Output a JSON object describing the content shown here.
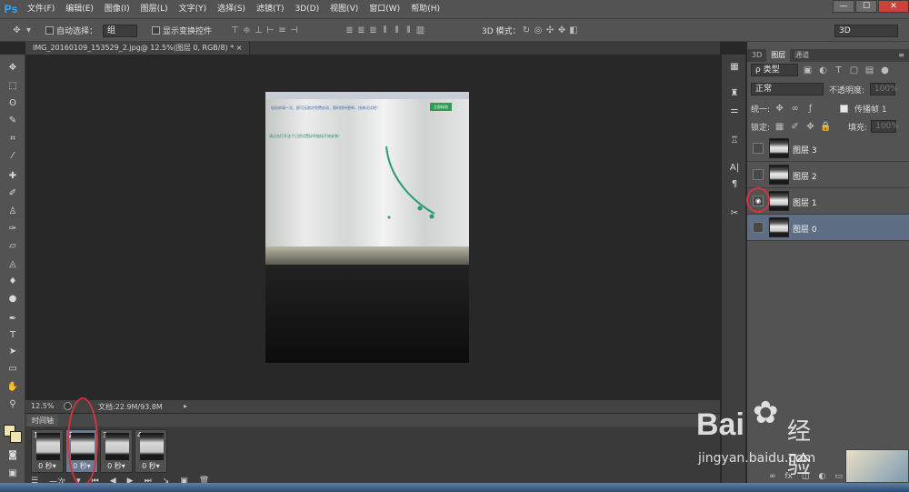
{
  "app": {
    "logo": "Ps"
  },
  "menu": [
    "文件(F)",
    "编辑(E)",
    "图像(I)",
    "图层(L)",
    "文字(Y)",
    "选择(S)",
    "滤镜(T)",
    "3D(D)",
    "视图(V)",
    "窗口(W)",
    "帮助(H)"
  ],
  "window_controls": [
    "—",
    "☐",
    "✕"
  ],
  "options": {
    "auto_select_label": "自动选择：",
    "auto_select_value": "组",
    "show_transform_label": "显示变换控件",
    "mode3d_label": "3D 模式：",
    "workspace": "3D"
  },
  "document": {
    "tab_title": "IMG_20160109_153529_2.jpg@ 12.5%(图层 0, RGB/8) *  ×"
  },
  "photo_text": {
    "line1": "轻松申请一次，即可无限次免费启动，随时保持更新，快来试试吧！",
    "button": "立即体验",
    "line2": "请点击打开这个已经设置好的链接开始安装！"
  },
  "status": {
    "zoom": "12.5%",
    "doc_info": "文档:22.9M/93.8M"
  },
  "timeline": {
    "tab": "时间轴",
    "frames": [
      {
        "num": "1",
        "dur": "0 秒▾"
      },
      {
        "num": "2",
        "dur": "0 秒▾"
      },
      {
        "num": "3",
        "dur": "0 秒▾"
      },
      {
        "num": "4",
        "dur": "0 秒▾"
      }
    ],
    "loop": "一次"
  },
  "panel": {
    "tabs": [
      "3D",
      "图层",
      "通道"
    ],
    "filter_kind": "ρ 类型",
    "blend": "正常",
    "opacity_label": "不透明度:",
    "opacity": "100%",
    "unify": "统一:",
    "propagate": "传播帧 1",
    "lock_label": "锁定:",
    "fill_label": "填充:",
    "fill": "100%"
  },
  "layers": [
    {
      "name": "图层 3"
    },
    {
      "name": "图层 2"
    },
    {
      "name": "图层 1"
    },
    {
      "name": "图层 0"
    }
  ],
  "watermark": {
    "brand": "Bai",
    "brand2": "经验",
    "url": "jingyan.baidu.com"
  },
  "colors": {
    "accent": "#31a8ff",
    "selected_layer": "#5d6e85",
    "annotation": "#d8333b"
  }
}
